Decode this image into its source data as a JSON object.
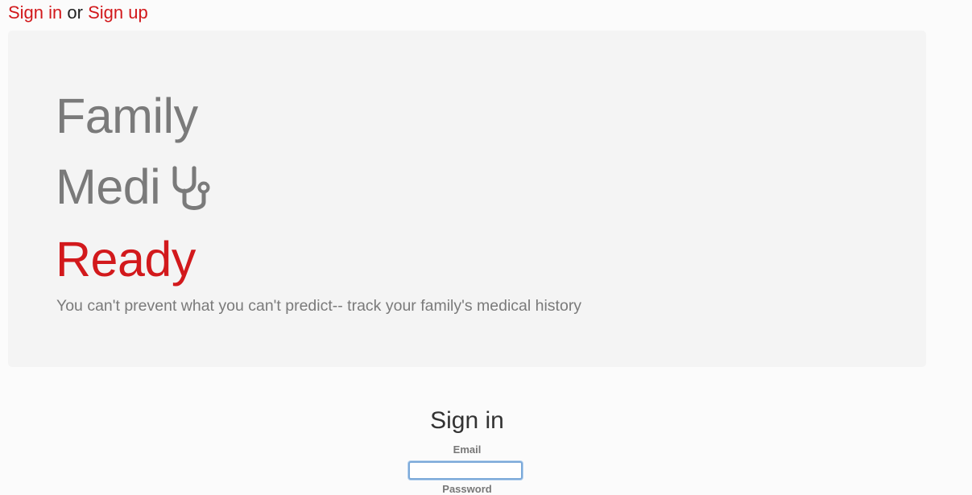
{
  "nav": {
    "sign_in": "Sign in",
    "or": "or",
    "sign_up": "Sign up"
  },
  "hero": {
    "line1": "Family",
    "line2": "Medi",
    "line3": "Ready",
    "stethoscope_icon": "stethoscope-icon",
    "tagline": "You can't prevent what you can't predict-- track your family's medical history"
  },
  "signin": {
    "title": "Sign in",
    "email_label": "Email",
    "email_value": "",
    "password_label": "Password"
  },
  "colors": {
    "brand_red": "#d2191c",
    "muted_gray": "#7a7a7a",
    "hero_bg": "#f4f4f4"
  }
}
